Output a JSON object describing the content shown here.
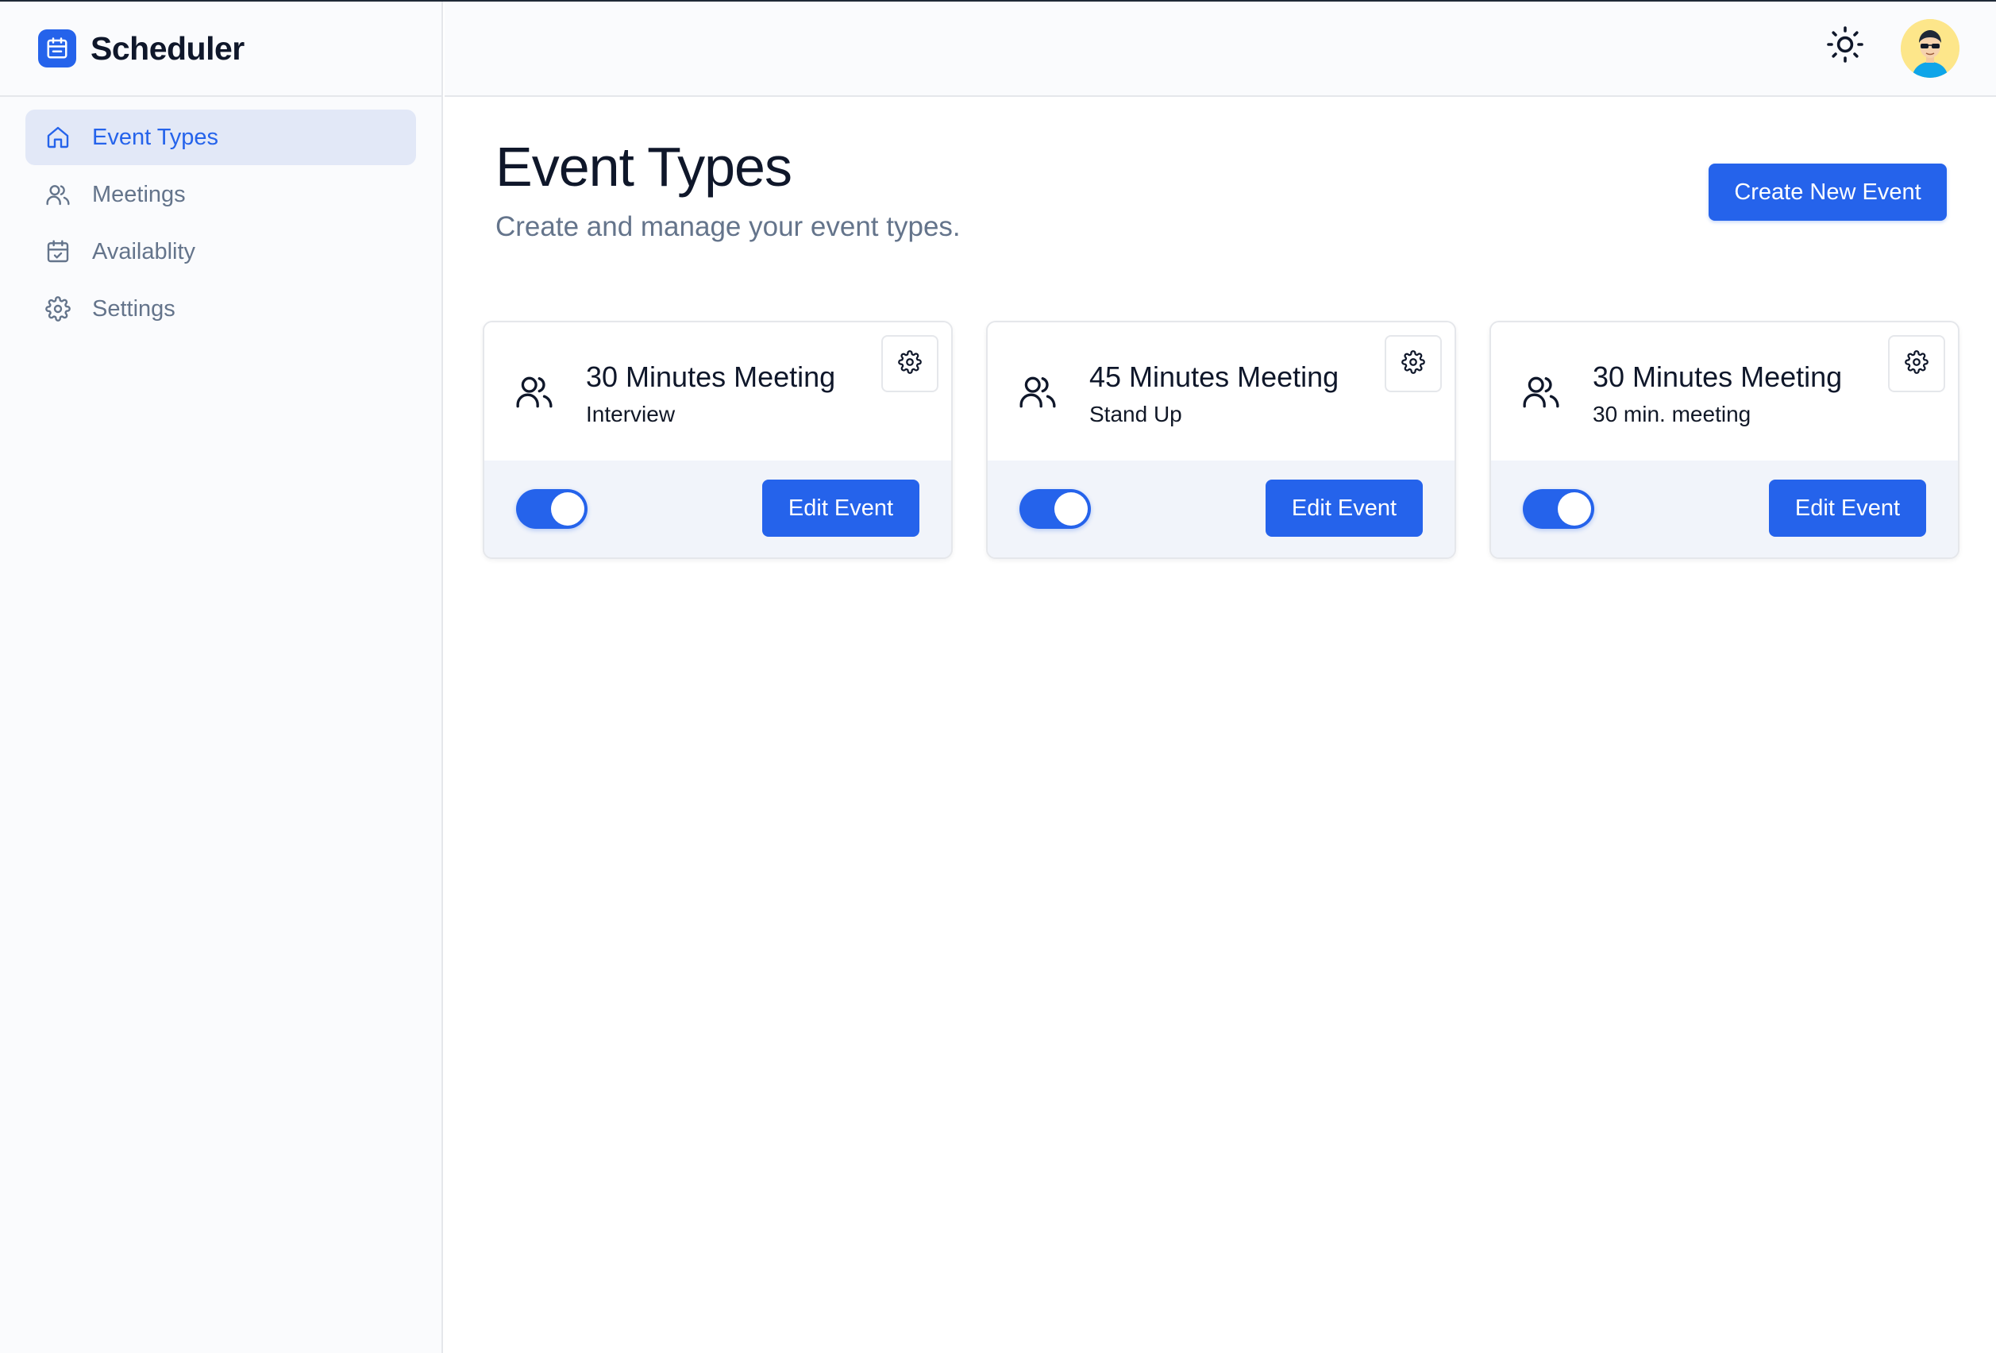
{
  "brand": {
    "name": "Scheduler",
    "icon": "calendar-icon",
    "accent": "#2563eb"
  },
  "sidebar": {
    "items": [
      {
        "label": "Event Types",
        "icon": "home-icon",
        "active": true
      },
      {
        "label": "Meetings",
        "icon": "users-icon",
        "active": false
      },
      {
        "label": "Availablity",
        "icon": "calendar-check-icon",
        "active": false
      },
      {
        "label": "Settings",
        "icon": "gear-icon",
        "active": false
      }
    ]
  },
  "header": {
    "theme_icon": "sun-icon",
    "avatar_icon": "user-avatar"
  },
  "main": {
    "title": "Event Types",
    "subtitle": "Create and manage your event types.",
    "create_button": "Create New Event",
    "cards": [
      {
        "title": "30 Minutes Meeting",
        "subtitle": "Interview",
        "enabled": true,
        "button": "Edit Event"
      },
      {
        "title": "45 Minutes Meeting",
        "subtitle": "Stand Up",
        "enabled": true,
        "button": "Edit Event"
      },
      {
        "title": "30 Minutes Meeting",
        "subtitle": "30 min. meeting",
        "enabled": true,
        "button": "Edit Event"
      }
    ]
  }
}
